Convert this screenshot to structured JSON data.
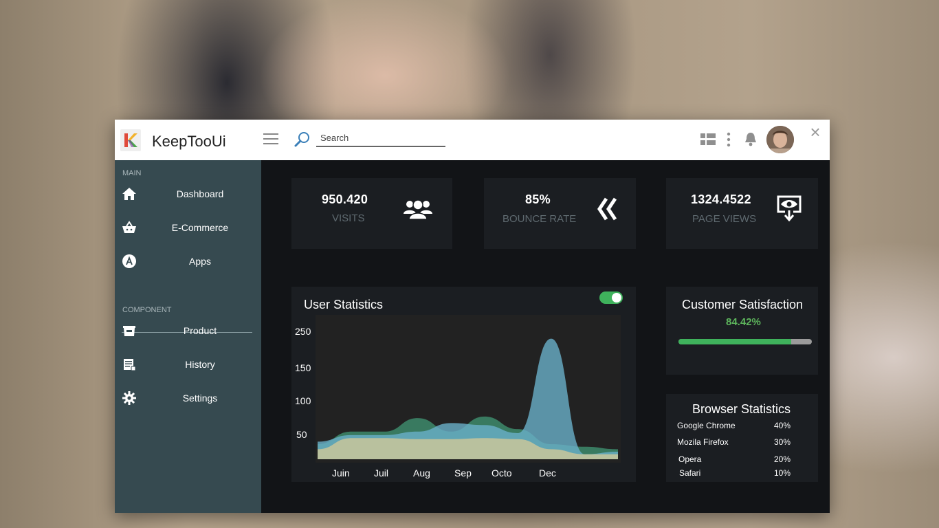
{
  "app": {
    "brand": "KeepTooUi"
  },
  "topbar": {
    "search": {
      "placeholder": "Search",
      "value": ""
    },
    "icons": [
      "menu-icon",
      "search-icon",
      "grid-icon",
      "more-vert-icon",
      "bell-icon",
      "avatar",
      "close-icon"
    ]
  },
  "sidebar": {
    "main_label": "MAIN",
    "main_items": [
      {
        "label": "Dashboard",
        "icon": "home-icon"
      },
      {
        "label": "E-Commerce",
        "icon": "basket-icon"
      },
      {
        "label": "Apps",
        "icon": "app-store-icon"
      }
    ],
    "component_label": "COMPONENT",
    "component_items": [
      {
        "label": "Product",
        "icon": "box-icon"
      },
      {
        "label": "History",
        "icon": "history-icon"
      },
      {
        "label": "Settings",
        "icon": "gear-icon"
      }
    ]
  },
  "stats": [
    {
      "value": "950.420",
      "label": "VISITS",
      "icon": "users-icon"
    },
    {
      "value": "85%",
      "label": "BOUNCE RATE",
      "icon": "double-chevron-left-icon"
    },
    {
      "value": "1324.4522",
      "label": "PAGE VIEWS",
      "icon": "eye-download-icon"
    }
  ],
  "user_statistics": {
    "title": "User Statistics",
    "toggle_on": true
  },
  "chart_data": {
    "type": "area",
    "title": "User Statistics",
    "categories": [
      "Juin",
      "Juil",
      "Aug",
      "Sep",
      "Octo",
      "Dec"
    ],
    "y_ticks": [
      "250",
      "150",
      "100",
      "50"
    ],
    "series": [
      {
        "color": "#3d8a6b",
        "values": [
          30,
          55,
          55,
          82,
          55,
          85,
          60,
          30,
          25,
          20
        ]
      },
      {
        "color": "#6ab0c9",
        "values": [
          35,
          48,
          48,
          55,
          72,
          68,
          52,
          240,
          10,
          15
        ]
      },
      {
        "color": "#c9c69a",
        "values": [
          20,
          42,
          42,
          40,
          40,
          42,
          40,
          20,
          10,
          10
        ]
      }
    ]
  },
  "customer_satisfaction": {
    "title": "Customer Satisfaction",
    "percent_text": "84.42%",
    "percent": 84.42
  },
  "browser_statistics": {
    "title": "Browser Statistics",
    "rows": [
      {
        "name": "Google Chrome",
        "value": "40%"
      },
      {
        "name": "Mozila Firefox",
        "value": "30%"
      },
      {
        "name": "Opera",
        "value": "20%"
      },
      {
        "name": "Safari",
        "value": "10%"
      }
    ]
  },
  "colors": {
    "accent": "#3fb25c",
    "sidebar": "#364a50",
    "card": "#1b1e22",
    "panel": "#121417"
  }
}
